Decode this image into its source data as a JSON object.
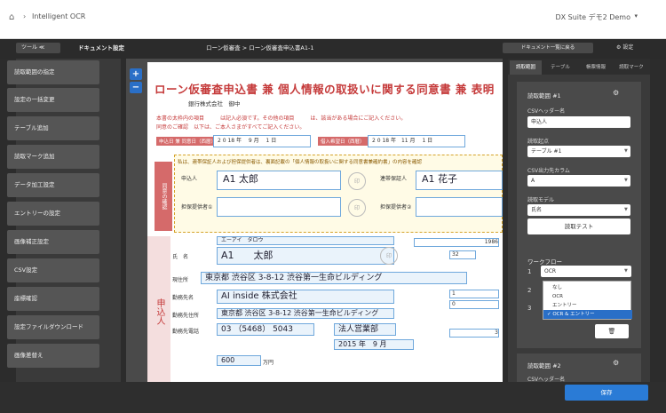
{
  "browser": {
    "app_title": "Intelligent OCR",
    "user": "DX Suite デモ2 Demo"
  },
  "toolbar": {
    "tool_label": "ツール ≪",
    "doc_settings": "ドキュメント設定",
    "breadcrumb": "ローン仮審査 > ローン仮審査申込書A1-1",
    "back_to_list": "ドキュメント一覧に戻る",
    "settings": "設定"
  },
  "sidebar": {
    "items": [
      "読取範囲の指定",
      "設定の一括変更",
      "テーブル追加",
      "読取マーク追加",
      "データ加工設定",
      "エントリーの設定",
      "画像補正設定",
      "CSV設定",
      "座標確認",
      "設定ファイルダウンロード",
      "画像差替え"
    ]
  },
  "viewer": {
    "zoom_in": "+",
    "zoom_out": "−"
  },
  "document": {
    "title": "ローン仮審査申込書 兼 個人情報の取扱いに関する同意書 兼 表明",
    "bank": "銀行株式会社　御中",
    "note1": "本書の太枠内の項目　　　は記入必須です。その他の項目　　　は、該当がある場合にご記入ください。",
    "note2": "同意のご確認　以下は、ご本人さまがすべてご記入ください。",
    "date_label1": "申込日 兼 同意日（西暦）",
    "date_value1": "2 0  18 年　 9 月　 1 日",
    "date_label2": "借入希望日（西暦）",
    "date_value2": "2 0  18 年　11 月　 1 日",
    "consent_line": "私は、連帯保証人および担保提供者は、裏面記載の「個人情報の取扱いに関する同意書兼確約書」の内容を確認",
    "confirm_label": "同意の確認",
    "applicant_label": "申込人",
    "applicant_name": "A1 太郎",
    "guarantor_label": "連帯保証人",
    "guarantor_name": "A1 花子",
    "collateral1": "担保提供者①",
    "collateral2": "担保提供者②",
    "seal": "印",
    "side_label": "申込人",
    "name_label": "氏　名",
    "name_value": "A1　　太郎",
    "furigana": "エーアイ　タロウ",
    "address_label": "現住所",
    "address_value": "東京都 渋谷区 3-8-12 渋谷第一生命ビルディング",
    "company_label": "勤務先名",
    "company_value": "AI inside 株式会社",
    "company_address_label": "勤務先住所",
    "company_address_value": "東京都 渋谷区 3-8-12 渋谷第一生命ビルディング",
    "phone_label": "勤務先電話",
    "phone_value": "03 （5468） 5043",
    "dept_value": "法人営業部",
    "hire_year": "2015 年　9 月",
    "income_value": "600",
    "yen_unit": "万円",
    "birth_year": "1986",
    "age": "32",
    "count1": "1",
    "count2": "0",
    "years": "3"
  },
  "panel": {
    "tabs": [
      "読取範囲",
      "テーブル",
      "帳票情報",
      "読取マーク"
    ],
    "group1_title": "読取範囲 #1",
    "csv_header_label": "CSVヘッダー名",
    "csv_header_value": "申込人",
    "start_point_label": "読取起点",
    "start_point_value": "テーブル #1",
    "csv_column_label": "CSV出力先カラム",
    "csv_column_value": "A",
    "model_label": "読取モデル",
    "model_value": "氏名",
    "test_button": "読取テスト",
    "workflow_label": "ワークフロー",
    "workflow_nums": [
      "1",
      "2",
      "3"
    ],
    "workflow_value": "OCR",
    "workflow_options": [
      "なし",
      "OCR",
      "エントリー",
      "✓ OCR & エントリー"
    ],
    "group2_title": "読取範囲 #2",
    "group2_csv_label": "CSVヘッダー名"
  },
  "footer": {
    "save": "保存"
  },
  "colors": {
    "accent": "#2a7bd6",
    "doc_red": "#c53a3a",
    "box_blue": "#6fa8dc"
  }
}
